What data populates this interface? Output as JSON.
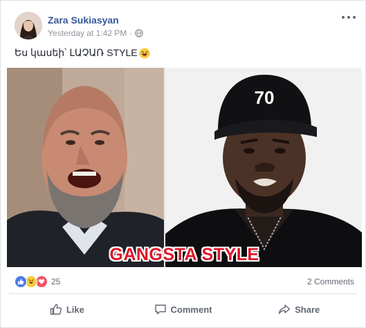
{
  "post": {
    "author": "Zara Sukiasyan",
    "timestamp": "Yesterday at 1:42 PM",
    "separator": "·",
    "privacy_icon": "globe-icon",
    "text": "Ես կասեի՝ ԼԱՉԱՌ STYLE",
    "text_emoji": "laughing-tears-emoji",
    "media": {
      "caption": "GANGSTA STYLE",
      "left_badge_text": "",
      "cap_text": "70"
    }
  },
  "reactions": {
    "types": [
      "like",
      "haha",
      "love"
    ],
    "count": "25",
    "comments": "2 Comments"
  },
  "actions": {
    "like": "Like",
    "comment": "Comment",
    "share": "Share"
  },
  "colors": {
    "author": "#365899",
    "secondary": "#90949c",
    "action": "#606770",
    "like": "#4a7bea",
    "haha": "#f7cb3f",
    "love": "#f25268",
    "caption": "#e0182a"
  }
}
